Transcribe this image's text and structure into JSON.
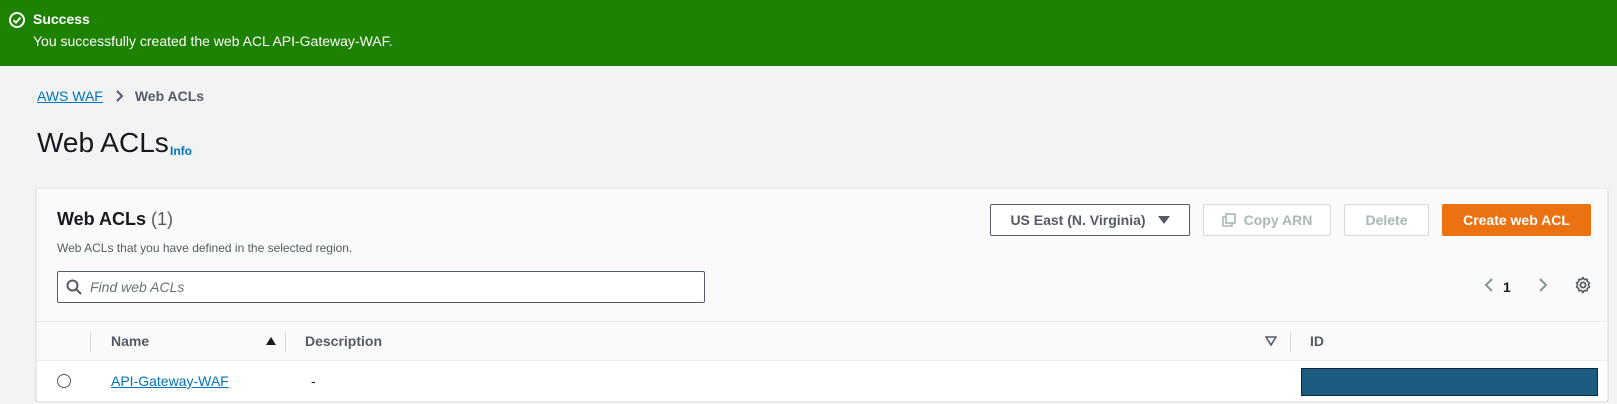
{
  "flash": {
    "title": "Success",
    "message": "You successfully created the web ACL API-Gateway-WAF.",
    "color": "#1d8102"
  },
  "breadcrumb": {
    "root": "AWS WAF",
    "current": "Web ACLs"
  },
  "page": {
    "title": "Web ACLs",
    "info_label": "Info"
  },
  "container": {
    "title": "Web ACLs",
    "count": "(1)",
    "description": "Web ACLs that you have defined in the selected region.",
    "region_select": "US East (N. Virginia)",
    "copy_arn_label": "Copy ARN",
    "delete_label": "Delete",
    "create_label": "Create web ACL",
    "accent_color": "#ec7211"
  },
  "search": {
    "placeholder": "Find web ACLs",
    "value": ""
  },
  "pagination": {
    "current_page": "1"
  },
  "table": {
    "columns": [
      "Name",
      "Description",
      "ID"
    ],
    "sort_column": "Name",
    "sort_direction": "ascending",
    "rows": [
      {
        "name": "API-Gateway-WAF",
        "description": "-",
        "id": ""
      }
    ]
  }
}
